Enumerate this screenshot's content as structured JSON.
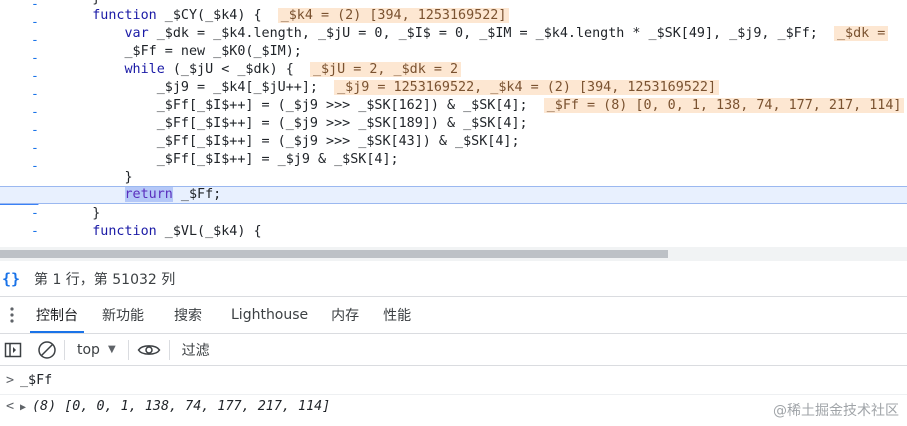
{
  "editor": {
    "gutter_marks": [
      "-",
      "-",
      "-",
      "-",
      "-",
      "-",
      "-",
      "-",
      "-",
      "-",
      "-",
      "-",
      "-"
    ],
    "lines": [
      {
        "code": "    }"
      },
      {
        "kw": "function",
        "code": " _$CY(_$k4) {",
        "hint": "_$k4 = (2) [394, 1253169522]"
      },
      {
        "indent": "        ",
        "kw": "var",
        "code": " _$dk = _$k4.length, _$jU = 0, _$I$ = 0, _$IM = _$k4.length * _$SK[49], _$j9, _$Ff;",
        "hint": "_$dk ="
      },
      {
        "code": "        _$Ff = new _$K0(_$IM);"
      },
      {
        "indent": "        ",
        "kw": "while",
        "code": " (_$jU < _$dk) {",
        "hint": "_$jU = 2, _$dk = 2"
      },
      {
        "code": "            _$j9 = _$k4[_$jU++];",
        "hint": "_$j9 = 1253169522, _$k4 = (2) [394, 1253169522]"
      },
      {
        "code": "            _$Ff[_$I$++] = (_$j9 >>> _$SK[162]) & _$SK[4];",
        "hint": "_$Ff = (8) [0, 0, 1, 138, 74, 177, 217, 114]"
      },
      {
        "code": "            _$Ff[_$I$++] = (_$j9 >>> _$SK[189]) & _$SK[4];"
      },
      {
        "code": "            _$Ff[_$I$++] = (_$j9 >>> _$SK[43]) & _$SK[4];"
      },
      {
        "code": "            _$Ff[_$I$++] = _$j9 & _$SK[4];"
      },
      {
        "code": "        }"
      },
      {
        "indent": "        ",
        "ret": "return",
        "code": " _$Ff;"
      },
      {
        "code": "    }"
      },
      {
        "kw": "function",
        "code": " _$VL(_$k4) {"
      }
    ]
  },
  "status": {
    "braces": "{}",
    "position_text": "第 1 行，第 51032 列"
  },
  "drawer_tabs": [
    "控制台",
    "新功能",
    "搜索",
    "Lighthouse",
    "内存",
    "性能"
  ],
  "console_toolbar": {
    "context": "top",
    "filter_placeholder": "过滤"
  },
  "console": {
    "input_prompt": ">",
    "input_text": "_$Ff",
    "result_prompt": "<",
    "result_text": "(8) [0, 0, 1, 138, 74, 177, 217, 114]"
  },
  "watermark": "@稀土掘金技术社区",
  "colors": {
    "accent": "#1a73e8",
    "breakpoint": "#3b82f6",
    "hint_bg": "#fde7d2",
    "keyword": "#1a1aa6"
  }
}
